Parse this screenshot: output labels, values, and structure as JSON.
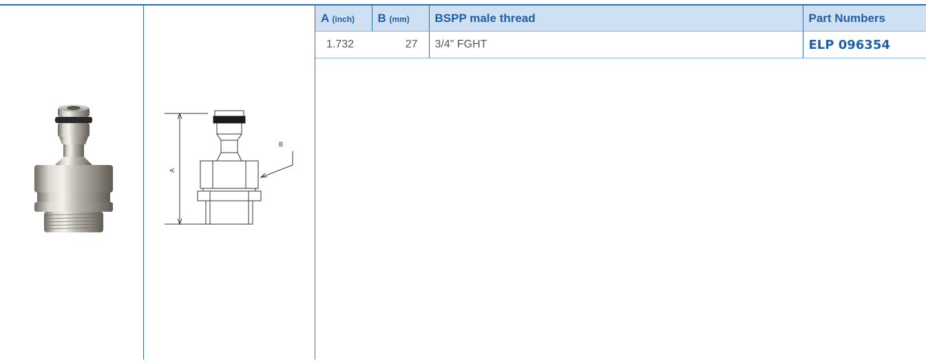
{
  "table": {
    "headers": {
      "a_label": "A",
      "a_unit": "(inch)",
      "b_label": "B",
      "b_unit": "(mm)",
      "thread": "BSPP male thread",
      "parts": "Part Numbers"
    },
    "rows": [
      {
        "a": "1.732",
        "b": "27",
        "thread": "3/4\" FGHT",
        "part": "ELP 096354"
      }
    ]
  },
  "drawing": {
    "label_a": "A",
    "label_b": "B"
  },
  "colors": {
    "accent": "#2a6db3",
    "header_bg": "#cfe0f2",
    "header_text": "#1f5ea8"
  }
}
